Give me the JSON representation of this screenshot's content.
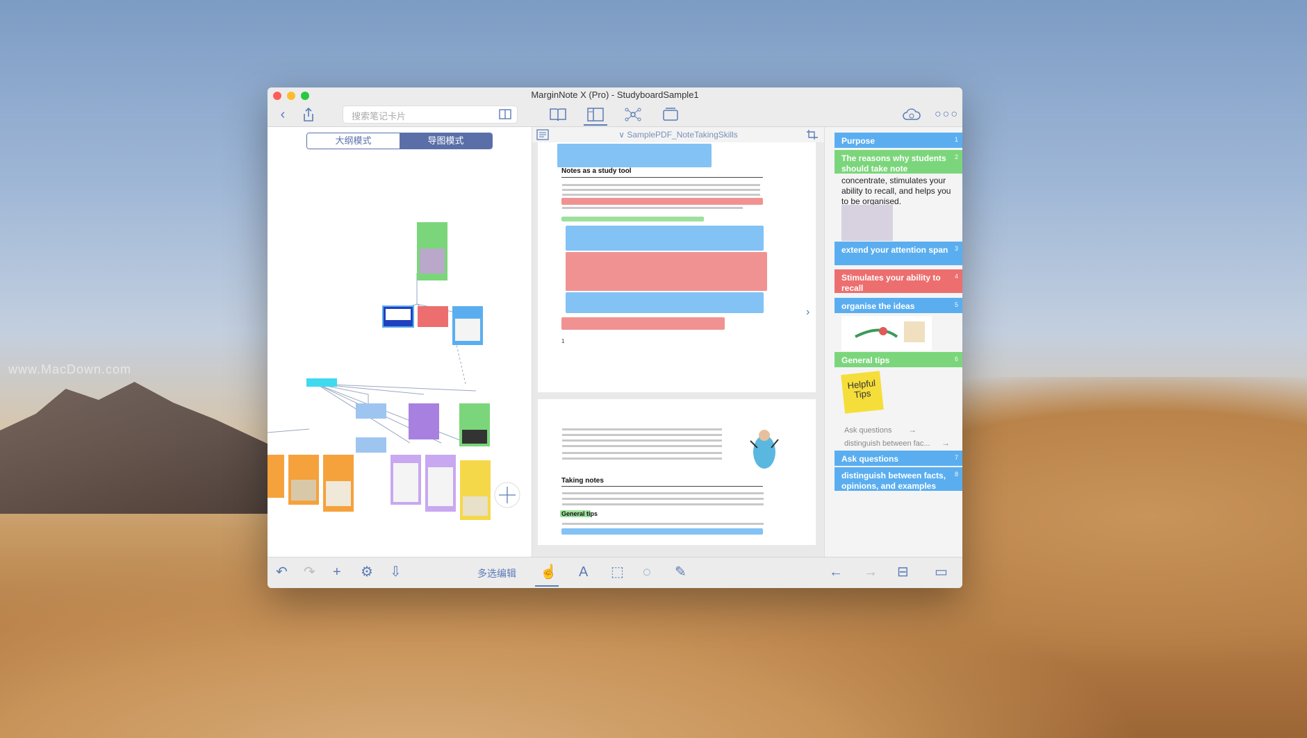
{
  "window": {
    "title": "MarginNote X (Pro) - StudyboardSample1"
  },
  "watermark": "www.MacDown.com",
  "search": {
    "placeholder": "搜索笔记卡片"
  },
  "left": {
    "tabs": [
      "大纲模式",
      "导图模式"
    ],
    "active_tab": 1
  },
  "doc": {
    "title": "SamplePDF_NoteTakingSkills",
    "headings": {
      "h1": "Notes as a study tool",
      "h2": "Taking notes",
      "h3": "General tips"
    },
    "page_number": "1"
  },
  "cards": [
    {
      "title": "Purpose",
      "num": "1",
      "color": "blue"
    },
    {
      "title": "The reasons why students should take note",
      "num": "2",
      "color": "green"
    },
    {
      "title": "extend your attention span",
      "num": "3",
      "color": "blue"
    },
    {
      "title": "Stimulates your ability to recall",
      "num": "4",
      "color": "red"
    },
    {
      "title": "organise the ideas",
      "num": "5",
      "color": "blue"
    },
    {
      "title": "General tips",
      "num": "6",
      "color": "green"
    },
    {
      "title": "Ask questions",
      "num": "7",
      "color": "blue"
    },
    {
      "title": "distinguish between facts, opinions, and examples",
      "num": "8",
      "color": "blue"
    }
  ],
  "card_text": "concentrate, stimulates your ability to recall, and helps you to be organised.",
  "helpful_tips": "Helpful Tips",
  "sub_items": [
    "Ask questions",
    "distinguish between fac..."
  ],
  "bottom": {
    "multi_edit": "多选编辑"
  }
}
